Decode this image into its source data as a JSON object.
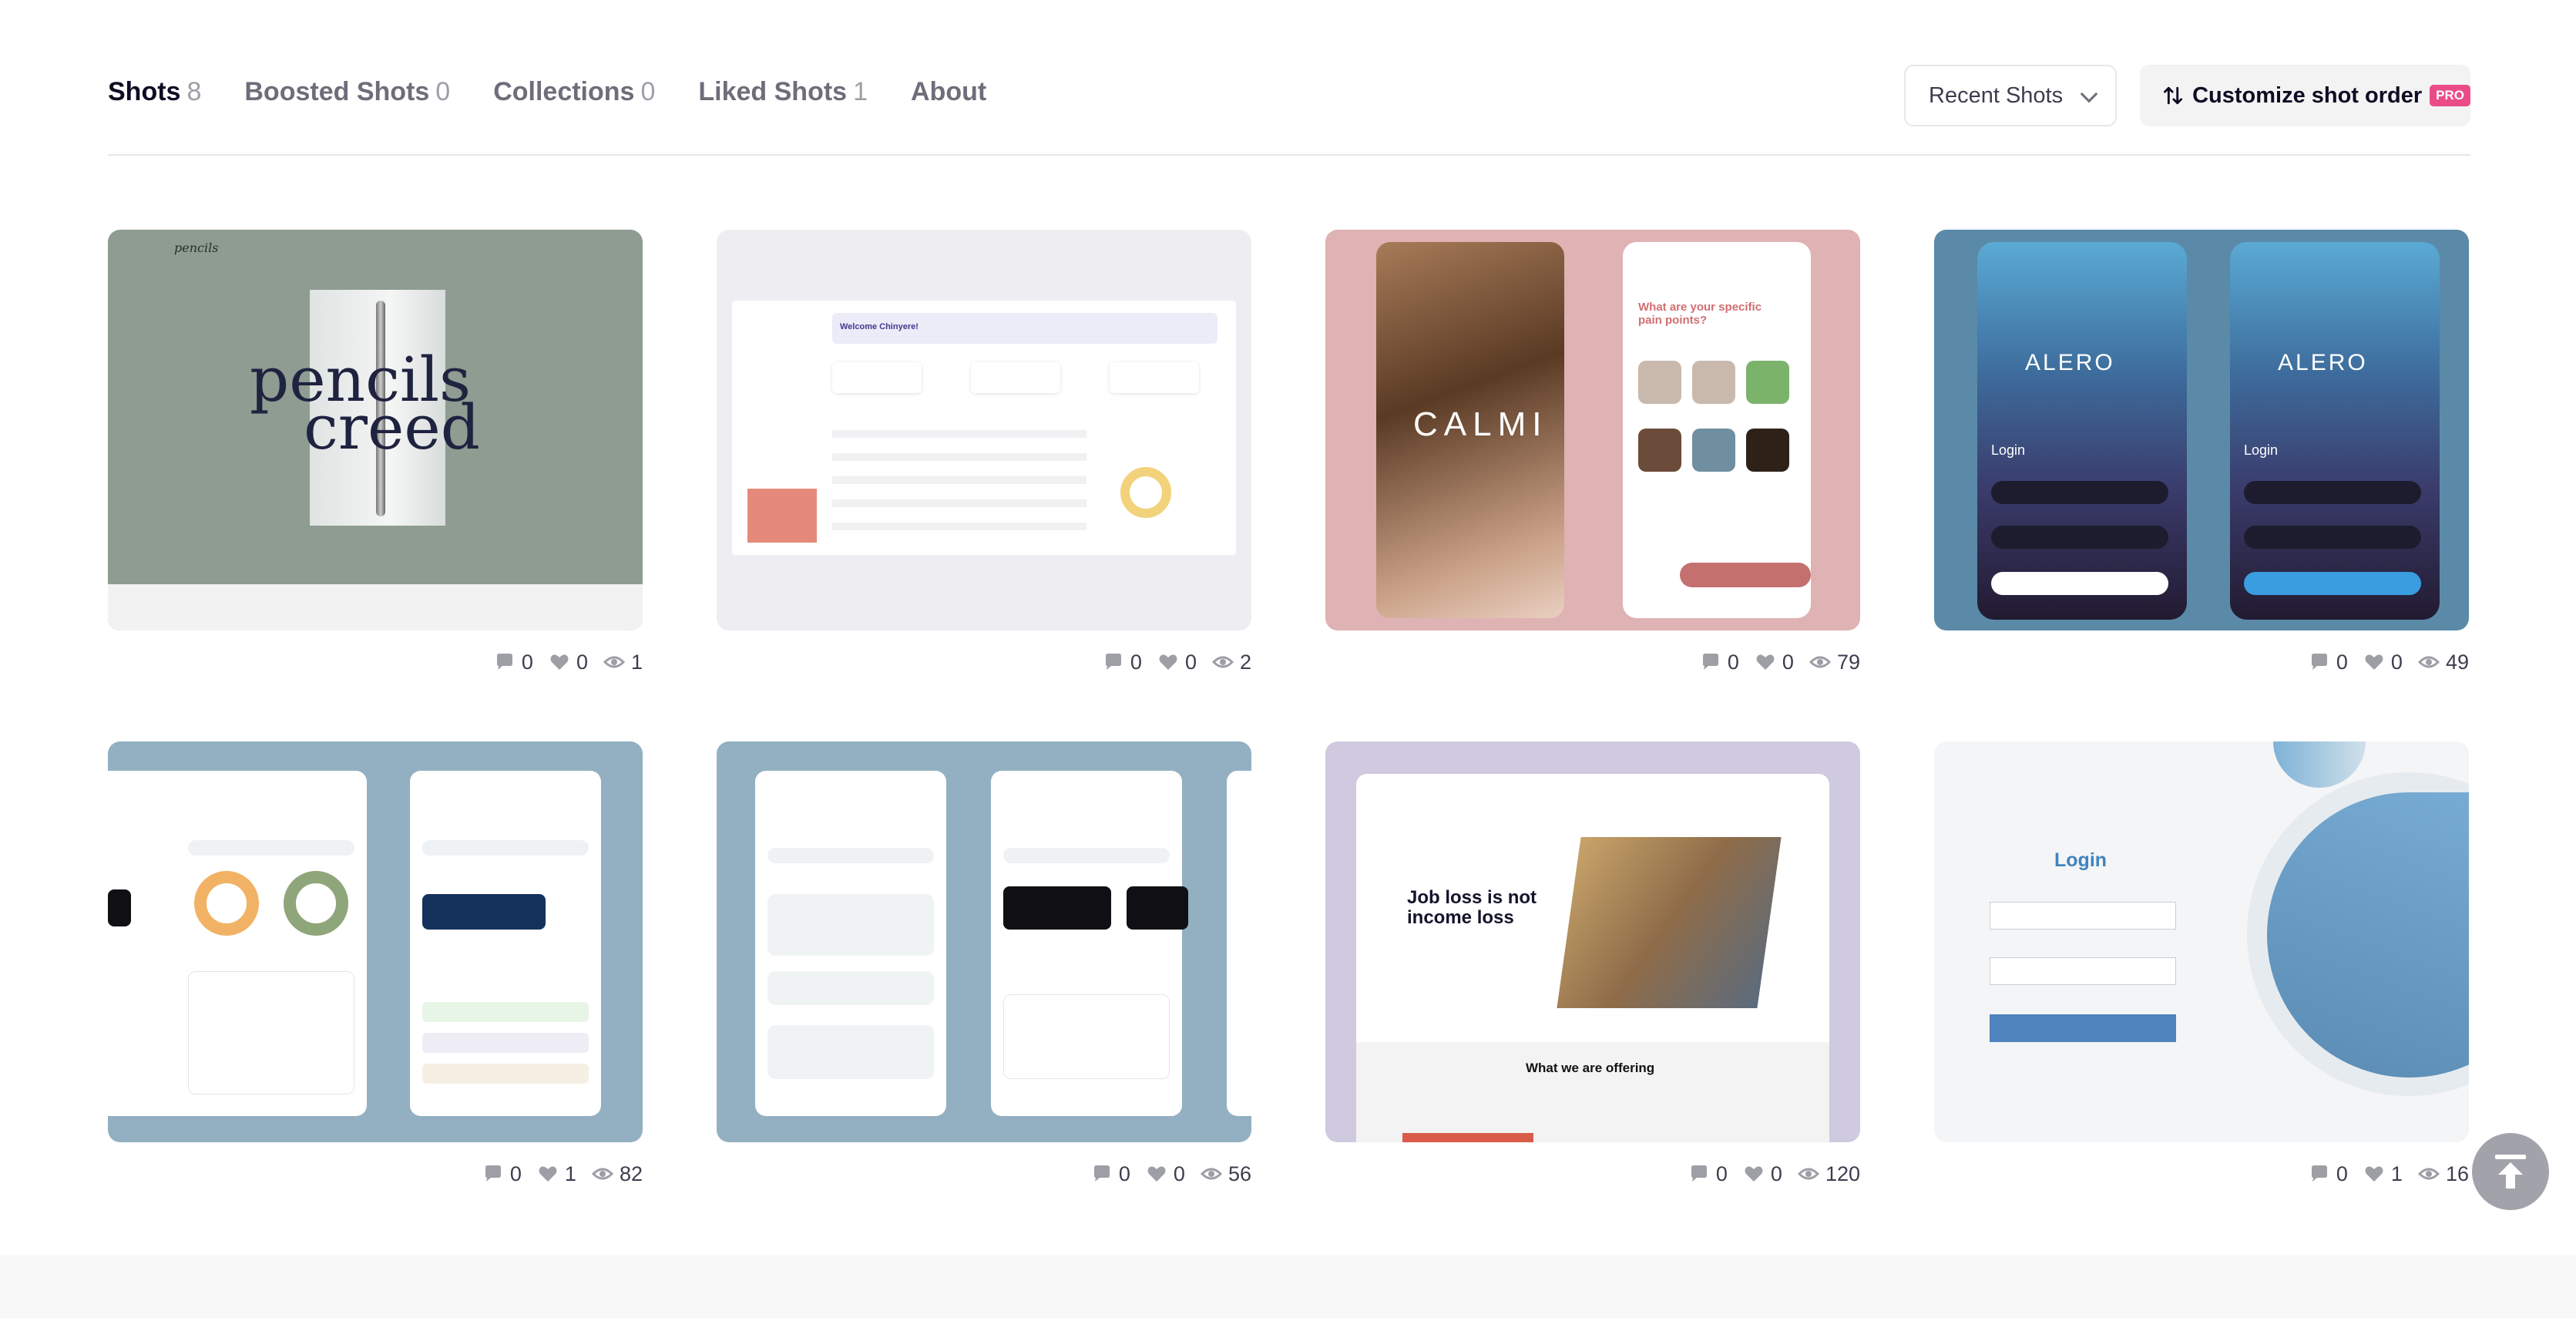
{
  "tabs": [
    {
      "label": "Shots",
      "count": "8"
    },
    {
      "label": "Boosted Shots",
      "count": "0"
    },
    {
      "label": "Collections",
      "count": "0"
    },
    {
      "label": "Liked Shots",
      "count": "1"
    },
    {
      "label": "About",
      "count": ""
    }
  ],
  "sort": {
    "selected": "Recent Shots"
  },
  "customize": {
    "label": "Customize shot order",
    "badge": "PRO"
  },
  "shots": [
    {
      "comments": "0",
      "likes": "0",
      "views": "1",
      "thumb_text": {
        "logo": "pencils",
        "title_line1": "pencils",
        "title_line2": "creed"
      }
    },
    {
      "comments": "0",
      "likes": "0",
      "views": "2",
      "thumb_text": {
        "welcome": "Welcome Chinyere!"
      }
    },
    {
      "comments": "0",
      "likes": "0",
      "views": "79",
      "thumb_text": {
        "brand": "CALMI",
        "question": "What are your specific pain points?"
      }
    },
    {
      "comments": "0",
      "likes": "0",
      "views": "49",
      "thumb_text": {
        "brand": "ALERO",
        "login": "Login"
      }
    },
    {
      "comments": "0",
      "likes": "1",
      "views": "82",
      "thumb_text": {}
    },
    {
      "comments": "0",
      "likes": "0",
      "views": "56",
      "thumb_text": {}
    },
    {
      "comments": "0",
      "likes": "0",
      "views": "120",
      "thumb_text": {
        "hero_line1": "Job loss is not",
        "hero_line2": "income loss",
        "offering": "What we are offering"
      }
    },
    {
      "comments": "0",
      "likes": "1",
      "views": "16",
      "thumb_text": {
        "login": "Login"
      }
    }
  ],
  "colors": {
    "accent": "#ea4c89",
    "text": "#0d0c22",
    "muted": "#6e6d7a"
  }
}
